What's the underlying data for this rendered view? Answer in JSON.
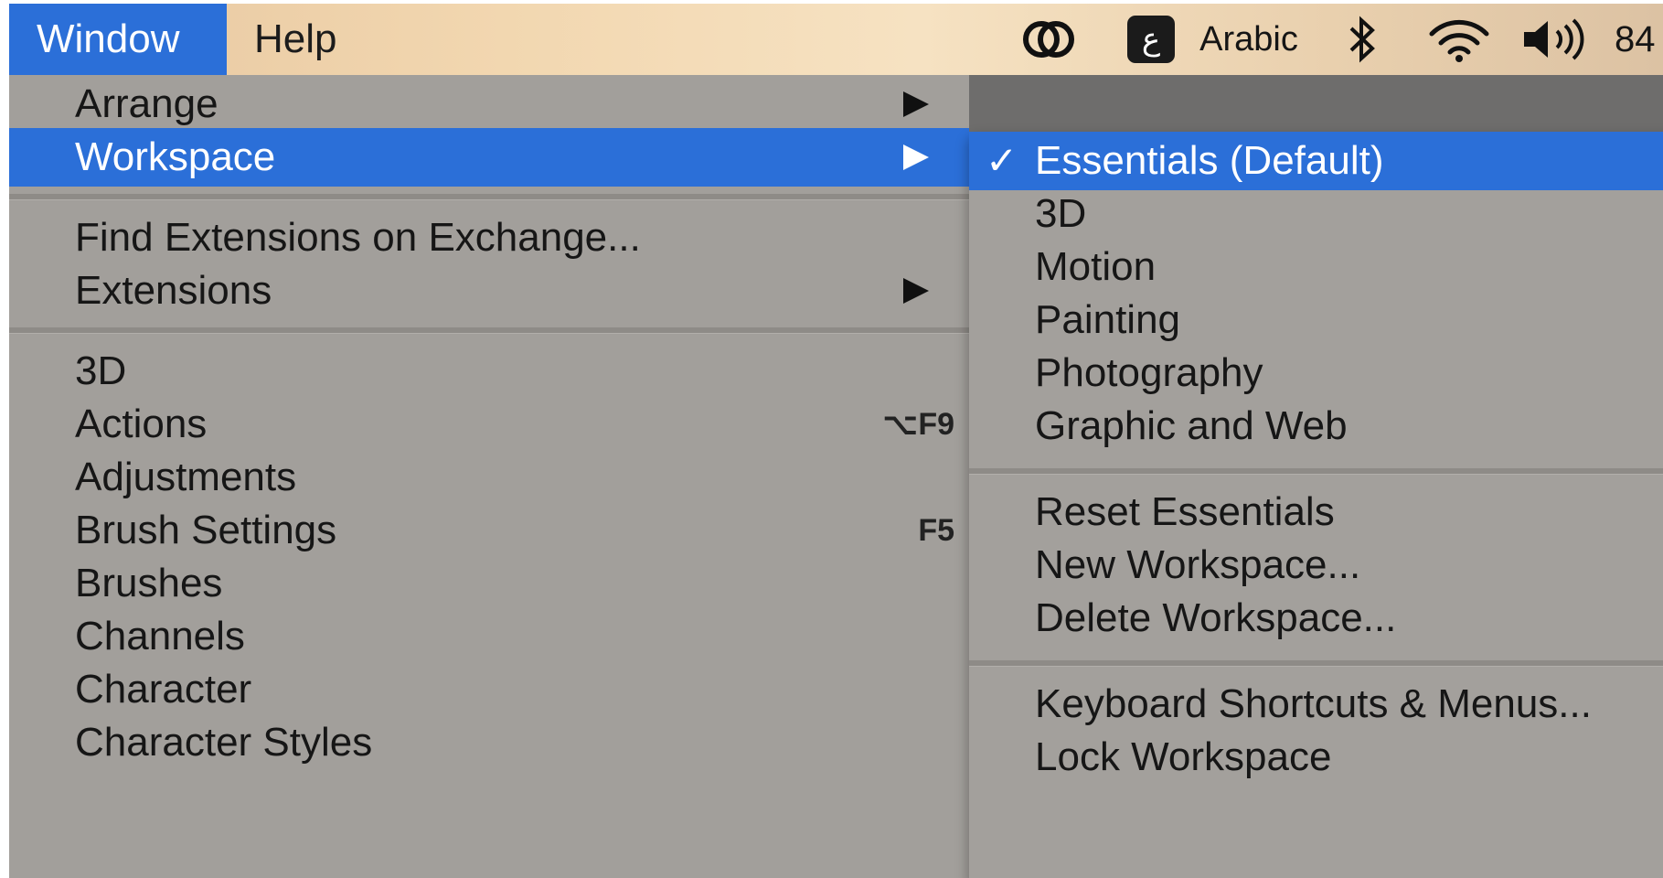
{
  "menubar": {
    "items": [
      {
        "label": "Window",
        "active": true
      },
      {
        "label": "Help",
        "active": false
      }
    ],
    "status": {
      "creative_cloud_icon": "creative-cloud-icon",
      "input_source_glyph": "ع",
      "input_source_name": "Arabic",
      "bluetooth_icon": "bluetooth-icon",
      "wifi_icon": "wifi-icon",
      "volume_icon": "volume-icon",
      "battery_text": "84"
    }
  },
  "window_menu": {
    "items": [
      {
        "label": "Arrange",
        "submenu": true
      },
      {
        "label": "Workspace",
        "submenu": true,
        "highlighted": true
      },
      {
        "label": "Find Extensions on Exchange..."
      },
      {
        "label": "Extensions",
        "submenu": true
      },
      {
        "label": "3D"
      },
      {
        "label": "Actions",
        "shortcut": "⌥F9"
      },
      {
        "label": "Adjustments"
      },
      {
        "label": "Brush Settings",
        "shortcut": "F5"
      },
      {
        "label": "Brushes"
      },
      {
        "label": "Channels"
      },
      {
        "label": "Character"
      },
      {
        "label": "Character Styles"
      }
    ]
  },
  "workspace_submenu": {
    "check_mark": "✓",
    "items": [
      {
        "label": "Essentials (Default)",
        "checked": true,
        "highlighted": true
      },
      {
        "label": "3D"
      },
      {
        "label": "Motion"
      },
      {
        "label": "Painting"
      },
      {
        "label": "Photography"
      },
      {
        "label": "Graphic and Web"
      },
      {
        "label": "Reset Essentials"
      },
      {
        "label": "New Workspace..."
      },
      {
        "label": "Delete Workspace..."
      },
      {
        "label": "Keyboard Shortcuts & Menus..."
      },
      {
        "label": "Lock Workspace"
      }
    ]
  },
  "colors": {
    "highlight": "#2b6fd8",
    "menu_background": "#a29f9b",
    "menubar_background": "#f2d7b0"
  }
}
